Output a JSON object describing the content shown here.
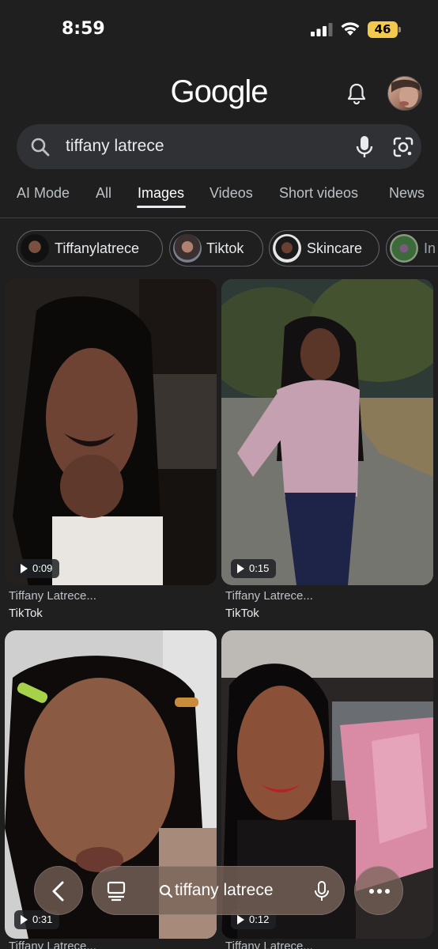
{
  "status_bar": {
    "time": "8:59",
    "battery": "46"
  },
  "header": {
    "logo": "Google"
  },
  "search": {
    "query": "tiffany latrece"
  },
  "tabs": [
    {
      "label": "AI Mode"
    },
    {
      "label": "All"
    },
    {
      "label": "Images",
      "active": true
    },
    {
      "label": "Videos"
    },
    {
      "label": "Short videos"
    },
    {
      "label": "News"
    }
  ],
  "chips": [
    {
      "label": "Tiffanylatrece"
    },
    {
      "label": "Tiktok"
    },
    {
      "label": "Skincare"
    },
    {
      "label": "In"
    }
  ],
  "results": [
    {
      "duration": "0:09",
      "title": "Tiffany Latrece...",
      "source": "TikTok"
    },
    {
      "duration": "0:15",
      "title": "Tiffany Latrece...",
      "source": "TikTok"
    },
    {
      "duration": "0:31",
      "title": "Tiffany Latrece..."
    },
    {
      "duration": "0:12",
      "title": "Tiffany Latrece..."
    }
  ],
  "bottom_bar": {
    "query": "tiffany latrece"
  },
  "colors": {
    "background": "#1f1f1f",
    "search_bg": "#303134",
    "accent_battery": "#f2c94c"
  }
}
